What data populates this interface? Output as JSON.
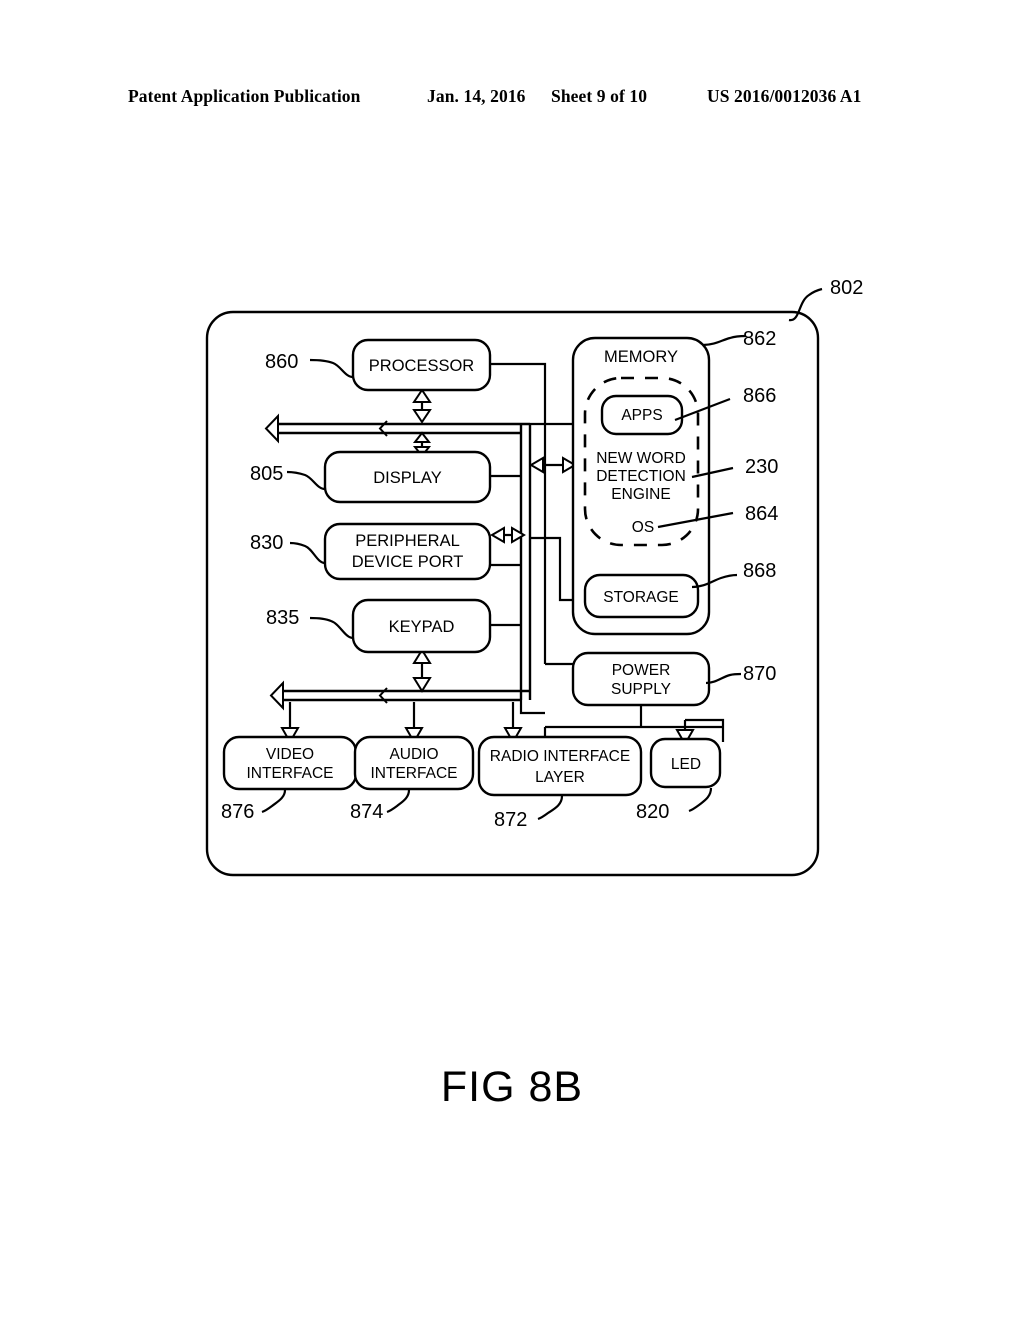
{
  "header": {
    "publication": "Patent Application Publication",
    "date": "Jan. 14, 2016",
    "sheet": "Sheet 9 of 10",
    "number": "US 2016/0012036 A1"
  },
  "figure": {
    "caption": "FIG 8B",
    "device_ref": "802"
  },
  "blocks": {
    "processor": {
      "label": "PROCESSOR",
      "ref": "860"
    },
    "display": {
      "label": "DISPLAY",
      "ref": "805"
    },
    "peripheral_device_port": {
      "label_line1": "PERIPHERAL",
      "label_line2": "DEVICE PORT",
      "ref": "830"
    },
    "keypad": {
      "label": "KEYPAD",
      "ref": "835"
    },
    "memory": {
      "label": "MEMORY",
      "ref": "862"
    },
    "apps": {
      "label": "APPS",
      "ref": "866"
    },
    "new_word_detection_engine": {
      "label_line1": "NEW WORD",
      "label_line2": "DETECTION",
      "label_line3": "ENGINE",
      "ref": "230"
    },
    "os": {
      "label": "OS",
      "ref": "864"
    },
    "storage": {
      "label": "STORAGE",
      "ref": "868"
    },
    "power_supply": {
      "label_line1": "POWER",
      "label_line2": "SUPPLY",
      "ref": "870"
    },
    "video_interface": {
      "label_line1": "VIDEO",
      "label_line2": "INTERFACE",
      "ref": "876"
    },
    "audio_interface": {
      "label_line1": "AUDIO",
      "label_line2": "INTERFACE",
      "ref": "874"
    },
    "radio_interface_layer": {
      "label_line1": "RADIO INTERFACE",
      "label_line2": "LAYER",
      "ref": "872"
    },
    "led": {
      "label": "LED",
      "ref": "820"
    }
  },
  "colors": {
    "ink": "#000000",
    "paper": "#ffffff"
  }
}
